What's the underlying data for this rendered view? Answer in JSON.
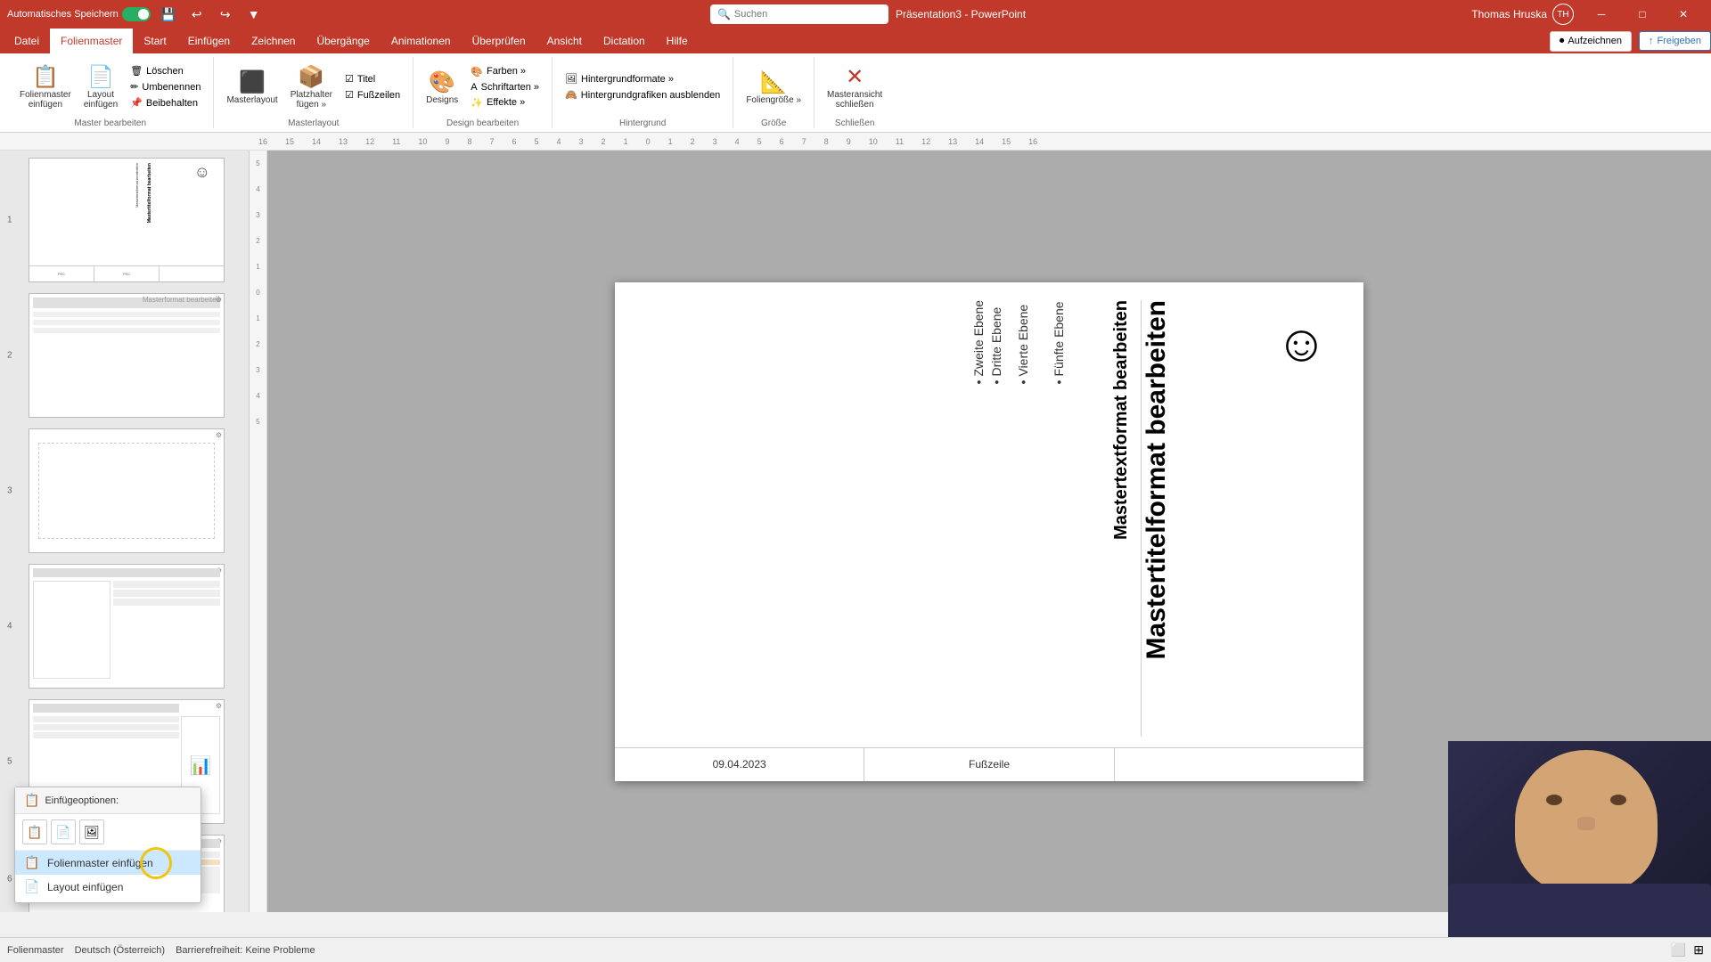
{
  "titlebar": {
    "autosave_label": "Automatisches Speichern",
    "app_title": "Präsentation3 - PowerPoint",
    "search_placeholder": "Suchen",
    "user_name": "Thomas Hruska",
    "user_initials": "TH"
  },
  "ribbon": {
    "tabs": [
      "Datei",
      "Folienmaster",
      "Start",
      "Einfügen",
      "Zeichnen",
      "Übergänge",
      "Animationen",
      "Überprüfen",
      "Ansicht",
      "Dictation",
      "Hilfe"
    ],
    "active_tab": "Folienmaster",
    "groups": {
      "master_bearbeiten": {
        "label": "Master bearbeiten",
        "btn_folienmaster": "Folienmaster\neinfügen",
        "btn_layout": "Layout\neinfügen",
        "btn_loeschen": "Löschen",
        "btn_umbenennen": "Umbenennen",
        "btn_beibehalten": "Beibehalten"
      },
      "masterlayout": {
        "label": "Masterlayout",
        "btn_masterlayout": "Masterlayout",
        "btn_platzhalter": "Platzhalter\nfügen »",
        "btn_titel": "Titel",
        "btn_fusszeilen": "Fußzeilen"
      },
      "design_bearbeiten": {
        "label": "Design bearbeiten",
        "btn_designs": "Designs",
        "btn_farben": "Farben »",
        "btn_schriftarten": "Schriftarten »",
        "btn_effekte": "Effekte »"
      },
      "hintergrund": {
        "label": "Hintergrund",
        "btn_hintergrundformate": "Hintergrundformate »",
        "btn_hintergrundgrafiken": "Hintergrundgrafiken ausblenden"
      },
      "groesse": {
        "label": "Größe",
        "btn_foliengroesse": "Foliengröße »"
      },
      "schliessen": {
        "label": "Schließen",
        "btn_masteransicht": "Masteransicht\nschließen"
      }
    },
    "record_btn": "Aufzeichnen",
    "share_btn": "Freigeben"
  },
  "context_menu": {
    "header": "Einfügeoptionen:",
    "items": [
      {
        "id": "folienmaster",
        "label": "Folienmaster einfügen",
        "active": true
      },
      {
        "id": "layout",
        "label": "Layout einfügen",
        "active": false
      }
    ]
  },
  "slide_canvas": {
    "title_text": "Mastertitelformat bearbeiten",
    "content_text": "Mastertextformat bearbeiten",
    "bullet_levels": [
      "Zweite Ebene",
      "Dritte Ebene",
      "Vierte Ebene",
      "Fünfte Ebene"
    ],
    "smiley": "☺",
    "footer_date": "09.04.2023",
    "footer_center": "Fußzeile",
    "footer_right": ""
  },
  "status_bar": {
    "view": "Folienmaster",
    "language": "Deutsch (Österreich)",
    "accessibility": "Barrierefreiheit: Keine Probleme"
  },
  "icons": {
    "search": "🔍",
    "save": "💾",
    "undo": "↩",
    "redo": "↪",
    "record_circle": "⏺",
    "share": "↑",
    "normal_view": "⬜",
    "slide_sorter": "⊞",
    "folienmaster_icon": "📋",
    "layout_icon": "📄"
  }
}
